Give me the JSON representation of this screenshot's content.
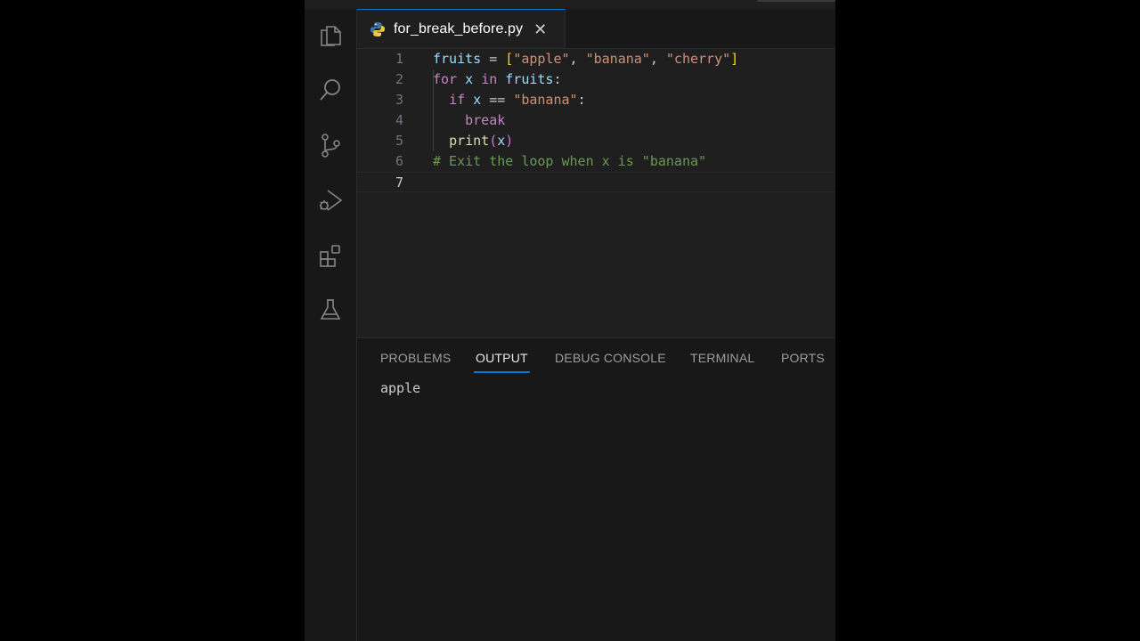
{
  "editor": {
    "tab": {
      "file_name": "for_break_before.py",
      "close_glyph": "✕",
      "icon": "python-icon"
    },
    "lines": [
      {
        "num": "1",
        "tokens": [
          {
            "t": "fruits",
            "c": "v"
          },
          {
            "t": " = ",
            "c": "p"
          },
          {
            "t": "[",
            "c": "b"
          },
          {
            "t": "\"apple\"",
            "c": "s"
          },
          {
            "t": ", ",
            "c": "p"
          },
          {
            "t": "\"banana\"",
            "c": "s"
          },
          {
            "t": ", ",
            "c": "p"
          },
          {
            "t": "\"cherry\"",
            "c": "s"
          },
          {
            "t": "]",
            "c": "b"
          }
        ]
      },
      {
        "num": "2",
        "tokens": [
          {
            "t": "for",
            "c": "k"
          },
          {
            "t": " ",
            "c": "p"
          },
          {
            "t": "x",
            "c": "v"
          },
          {
            "t": " ",
            "c": "p"
          },
          {
            "t": "in",
            "c": "k"
          },
          {
            "t": " ",
            "c": "p"
          },
          {
            "t": "fruits",
            "c": "v"
          },
          {
            "t": ":",
            "c": "p"
          }
        ]
      },
      {
        "num": "3",
        "tokens": [
          {
            "t": "  ",
            "c": "p"
          },
          {
            "t": "if",
            "c": "k"
          },
          {
            "t": " ",
            "c": "p"
          },
          {
            "t": "x",
            "c": "v"
          },
          {
            "t": " == ",
            "c": "p"
          },
          {
            "t": "\"banana\"",
            "c": "s"
          },
          {
            "t": ":",
            "c": "p"
          }
        ]
      },
      {
        "num": "4",
        "tokens": [
          {
            "t": "    ",
            "c": "p"
          },
          {
            "t": "break",
            "c": "k"
          }
        ]
      },
      {
        "num": "5",
        "tokens": [
          {
            "t": "  ",
            "c": "p"
          },
          {
            "t": "print",
            "c": "f"
          },
          {
            "t": "(",
            "c": "b2"
          },
          {
            "t": "x",
            "c": "v"
          },
          {
            "t": ")",
            "c": "b2"
          }
        ]
      },
      {
        "num": "6",
        "tokens": [
          {
            "t": "# Exit the loop when x is \"banana\"",
            "c": "c"
          }
        ]
      },
      {
        "num": "7",
        "tokens": [],
        "active": true
      }
    ]
  },
  "activity_bar": [
    "explorer-icon",
    "search-icon",
    "source-control-icon",
    "run-debug-icon",
    "extensions-icon",
    "testing-icon"
  ],
  "panel": {
    "tabs": [
      "PROBLEMS",
      "OUTPUT",
      "DEBUG CONSOLE",
      "TERMINAL",
      "PORTS"
    ],
    "active_tab": "OUTPUT",
    "output_text": "apple"
  },
  "colors": {
    "accent": "#0078d4",
    "background": "#181818",
    "editor_background": "#1f1f1f"
  }
}
